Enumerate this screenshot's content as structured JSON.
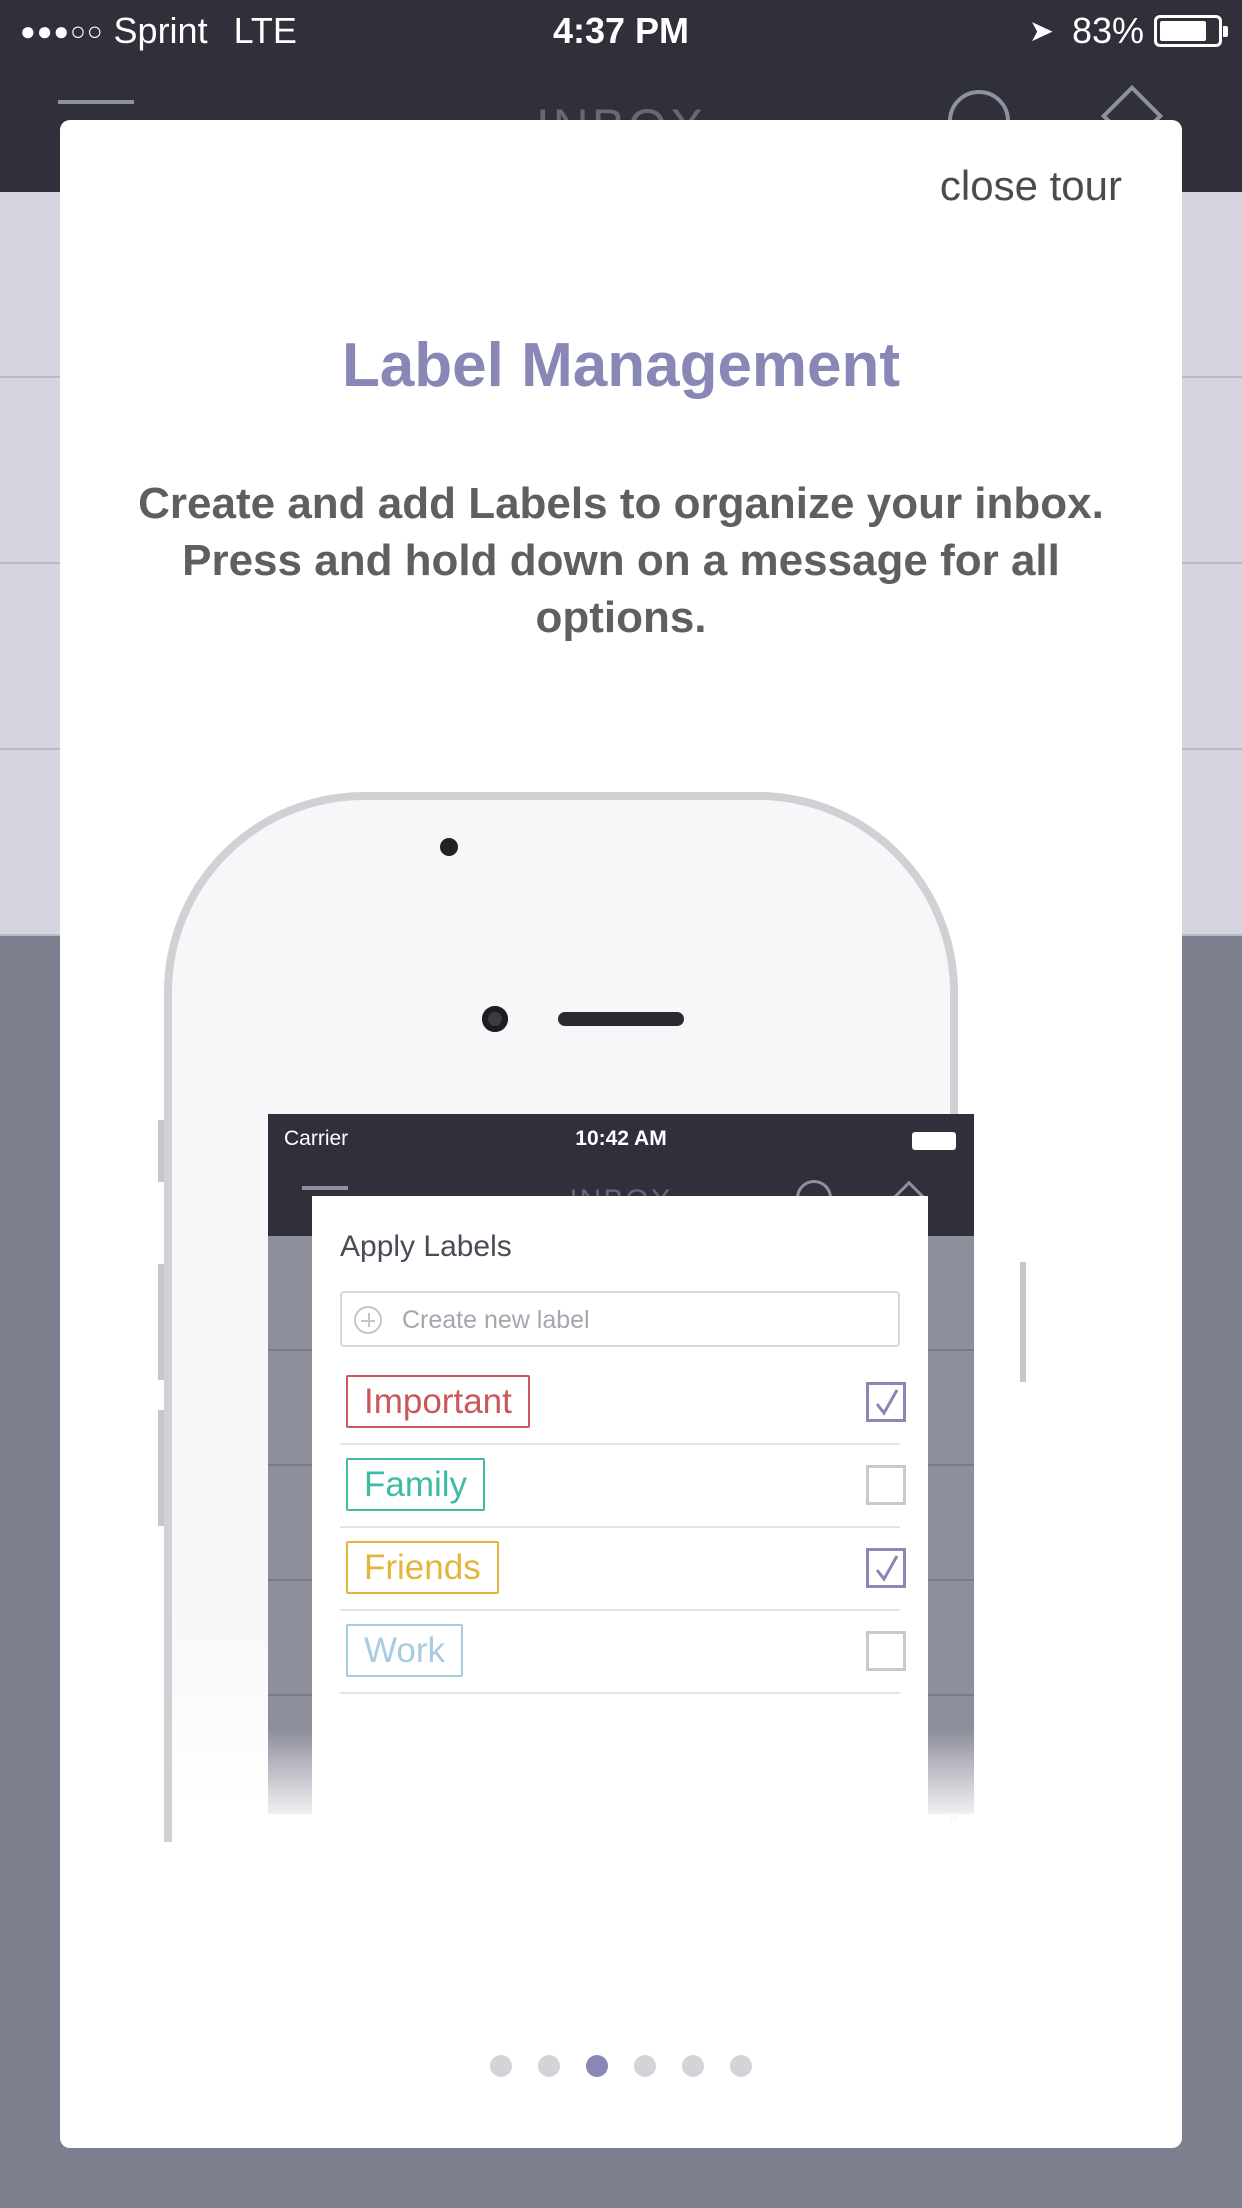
{
  "status_bar": {
    "signal": "●●●○○",
    "carrier": "Sprint",
    "network": "LTE",
    "time": "4:37 PM",
    "battery": "83%",
    "battery_level": 0.83
  },
  "app": {
    "title": "INBOX"
  },
  "tour": {
    "close_label": "close tour",
    "title": "Label Management",
    "description": "Create and add Labels to organize your inbox. Press and hold down on a message for all options.",
    "pager": {
      "count": 6,
      "active_index": 2
    }
  },
  "illustration": {
    "carrier": "Carrier",
    "time": "10:42 AM",
    "inbox_title": "INBOX",
    "popup": {
      "title": "Apply Labels",
      "input_placeholder": "Create new label",
      "labels": [
        {
          "name": "Important",
          "color": "#c9585d",
          "checked": true
        },
        {
          "name": "Family",
          "color": "#3fbba4",
          "checked": false
        },
        {
          "name": "Friends",
          "color": "#e3b53a",
          "checked": true
        },
        {
          "name": "Work",
          "color": "#a7cbe0",
          "checked": false
        }
      ]
    }
  },
  "colors": {
    "accent": "#8887b5",
    "nav_bar": "#2f303a",
    "overlay": "#7c7f8e"
  }
}
